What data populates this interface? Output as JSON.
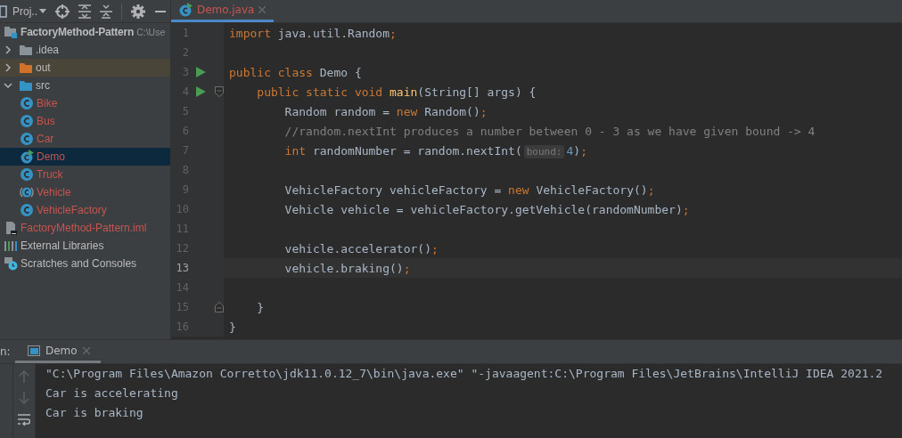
{
  "project_panel": {
    "title": "Proj..",
    "tree": [
      {
        "label": "FactoryMethod-Pattern",
        "path": "C:\\Use",
        "kind": "module",
        "selected": false,
        "unversioned": false,
        "children": [
          {
            "label": ".idea",
            "kind": "folder",
            "expanded": false,
            "selected": false,
            "unversioned": false
          },
          {
            "label": "out",
            "kind": "excluded-folder",
            "expanded": false,
            "selected": false,
            "unversioned": false
          },
          {
            "label": "src",
            "kind": "source-folder",
            "expanded": true,
            "selected": false,
            "unversioned": false,
            "children": [
              {
                "label": "Bike",
                "kind": "class",
                "selected": false,
                "unversioned": true
              },
              {
                "label": "Bus",
                "kind": "class",
                "selected": false,
                "unversioned": true
              },
              {
                "label": "Car",
                "kind": "class",
                "selected": false,
                "unversioned": true
              },
              {
                "label": "Demo",
                "kind": "runnable-class",
                "selected": true,
                "unversioned": true
              },
              {
                "label": "Truck",
                "kind": "class",
                "selected": false,
                "unversioned": true
              },
              {
                "label": "Vehicle",
                "kind": "abstract-class",
                "selected": false,
                "unversioned": true
              },
              {
                "label": "VehicleFactory",
                "kind": "class",
                "selected": false,
                "unversioned": true
              }
            ]
          },
          {
            "label": "FactoryMethod-Pattern.iml",
            "kind": "file",
            "selected": false,
            "unversioned": true
          }
        ]
      },
      {
        "label": "External Libraries",
        "kind": "libraries",
        "selected": false,
        "unversioned": false
      },
      {
        "label": "Scratches and Consoles",
        "kind": "scratches",
        "selected": false,
        "unversioned": false
      }
    ]
  },
  "editor": {
    "tabs": [
      {
        "label": "Demo.java",
        "selected": true,
        "unversioned": true
      }
    ],
    "lines": [
      {
        "number": "1",
        "run": false,
        "current": false,
        "tokens": [
          {
            "kind": "keyword",
            "text": "import"
          },
          {
            "kind": "plain",
            "text": " java.util.Random"
          },
          {
            "kind": "keyword",
            "text": ";"
          }
        ]
      },
      {
        "number": "2",
        "run": false,
        "current": false
      },
      {
        "number": "3",
        "run": true,
        "current": false,
        "tokens": [
          {
            "kind": "keyword",
            "text": "public class"
          },
          {
            "kind": "plain",
            "text": " Demo {"
          }
        ]
      },
      {
        "number": "4",
        "run": true,
        "fold_start": true,
        "current": false,
        "tokens": [
          {
            "kind": "keyword",
            "text": "    public static void "
          },
          {
            "kind": "method",
            "text": "main"
          },
          {
            "kind": "plain",
            "text": "(String[] args) {"
          }
        ]
      },
      {
        "number": "5",
        "run": false,
        "current": false,
        "tokens": [
          {
            "kind": "plain",
            "text": "        Random random = "
          },
          {
            "kind": "keyword",
            "text": "new"
          },
          {
            "kind": "plain",
            "text": " Random()"
          },
          {
            "kind": "keyword",
            "text": ";"
          }
        ]
      },
      {
        "number": "6",
        "run": false,
        "current": false,
        "tokens": [
          {
            "kind": "comment",
            "text": "        //random.nextInt produces a number between 0 - 3 as we have given bound -> 4"
          }
        ]
      },
      {
        "number": "7",
        "run": false,
        "current": false,
        "tokens": [
          {
            "kind": "keyword",
            "text": "        int"
          },
          {
            "kind": "plain",
            "text": " randomNumber = random.nextInt("
          },
          {
            "kind": "hint",
            "text": "bound:"
          },
          {
            "kind": "number",
            "text": "4"
          },
          {
            "kind": "plain",
            "text": ")"
          },
          {
            "kind": "keyword",
            "text": ";"
          }
        ]
      },
      {
        "number": "8",
        "run": false,
        "current": false
      },
      {
        "number": "9",
        "run": false,
        "current": false,
        "tokens": [
          {
            "kind": "plain",
            "text": "        VehicleFactory vehicleFactory = "
          },
          {
            "kind": "keyword",
            "text": "new"
          },
          {
            "kind": "plain",
            "text": " VehicleFactory()"
          },
          {
            "kind": "keyword",
            "text": ";"
          }
        ]
      },
      {
        "number": "10",
        "run": false,
        "current": false,
        "tokens": [
          {
            "kind": "plain",
            "text": "        Vehicle vehicle = vehicleFactory.getVehicle(randomNumber)"
          },
          {
            "kind": "keyword",
            "text": ";"
          }
        ]
      },
      {
        "number": "11",
        "run": false,
        "current": false
      },
      {
        "number": "12",
        "run": false,
        "current": false,
        "tokens": [
          {
            "kind": "plain",
            "text": "        vehicle.accelerator()"
          },
          {
            "kind": "keyword",
            "text": ";"
          }
        ]
      },
      {
        "number": "13",
        "run": false,
        "current": true,
        "tokens": [
          {
            "kind": "plain",
            "text": "        vehicle.braking()"
          },
          {
            "kind": "keyword",
            "text": ";"
          }
        ]
      },
      {
        "number": "14",
        "run": false,
        "current": false
      },
      {
        "number": "15",
        "run": false,
        "fold_end": true,
        "current": false,
        "tokens": [
          {
            "kind": "plain",
            "text": "    }"
          }
        ]
      },
      {
        "number": "16",
        "run": false,
        "current": false,
        "tokens": [
          {
            "kind": "plain",
            "text": "}"
          }
        ]
      }
    ]
  },
  "run_panel": {
    "label": "n:",
    "tabs": [
      {
        "label": "Demo",
        "selected": true
      }
    ],
    "output": [
      "\"C:\\Program Files\\Amazon Corretto\\jdk11.0.12_7\\bin\\java.exe\" \"-javaagent:C:\\Program Files\\JetBrains\\IntelliJ IDEA 2021.2",
      "Car is accelerating",
      "Car is braking"
    ]
  }
}
